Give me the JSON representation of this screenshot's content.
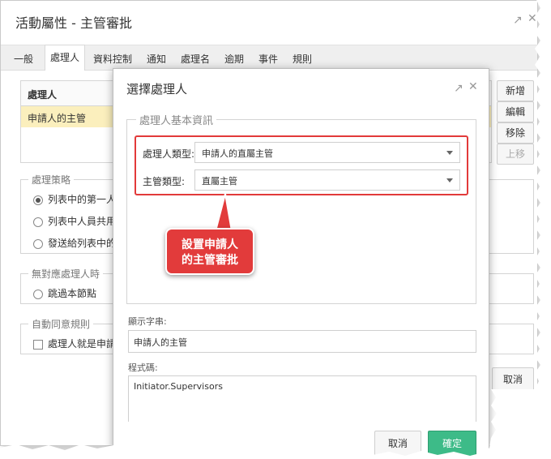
{
  "outer": {
    "title": "活動屬性 - 主管審批",
    "tabs": [
      "一般",
      "處理人",
      "資料控制",
      "通知",
      "處理名",
      "逾期",
      "事件",
      "規則"
    ],
    "active_tab": "處理人",
    "handler_table": {
      "header": "處理人",
      "rows": [
        "申請人的主管"
      ]
    },
    "side_buttons": {
      "add": "新增",
      "edit": "編輯",
      "remove": "移除",
      "up": "上移"
    },
    "strategy_group": {
      "legend": "處理策略",
      "options": [
        "列表中的第一人",
        "列表中人員共用",
        "發送給列表中的"
      ],
      "selected_index": 0
    },
    "no_handler_group": {
      "legend": "無對應處理人時",
      "option": "跳過本節點"
    },
    "auto_agree_group": {
      "legend": "自動同意規則",
      "option": "處理人就是申請"
    },
    "cancel_label": "取消"
  },
  "modal": {
    "title": "選擇處理人",
    "basic_info_legend": "處理人基本資訊",
    "handler_type_label": "處理人類型:",
    "handler_type_value": "申請人的直屬主管",
    "supervisor_type_label": "主管類型:",
    "supervisor_type_value": "直屬主管",
    "callout_text": "設置申請人\n的主管審批",
    "callout_line1": "設置申請人",
    "callout_line2": "的主管審批",
    "display_label": "顯示字串:",
    "display_value": "申請人的主管",
    "code_label": "程式碼:",
    "code_value": "Initiator.Supervisors",
    "cancel_label": "取消",
    "ok_label": "確定",
    "accent_color": "#3dbb88",
    "highlight_color": "#e23a3a"
  }
}
